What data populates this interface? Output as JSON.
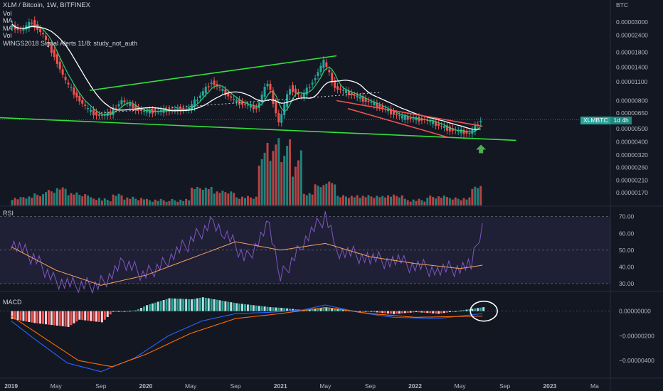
{
  "header": {
    "title": "XLM / Bitcoin, 1W, BITFINEX",
    "indicators": [
      "Vol",
      "MA",
      "MA",
      "Vol",
      "WINGS2018 Signal Alerts 11/8: study_not_auth"
    ]
  },
  "price_scale": {
    "currency": "BTC"
  },
  "price_badge": {
    "symbol": "XLMBTC",
    "countdown": "1d 4h"
  },
  "panes": {
    "rsi_label": "RSI",
    "macd_label": "MACD"
  },
  "colors": {
    "background": "#131722",
    "up": "#26a69a",
    "down": "#ef5350",
    "trendline": "#32e03c",
    "ma_fast": "#2ecc71",
    "ma_slow": "#ffffff",
    "rsi": "#7e57c2",
    "rsi_ma": "#f4a261",
    "macd": "#2962ff",
    "signal": "#ff6d00",
    "arrow": "#4caf50"
  },
  "chart_data": [
    {
      "type": "candlestick",
      "title": "XLM / Bitcoin, 1W, BITFINEX",
      "log_scale": true,
      "y_ticks": [
        "0.00003000",
        "0.00002400",
        "0.00001800",
        "0.00001400",
        "0.00001100",
        "0.00000800",
        "0.00000650",
        "0.00000500",
        "0.00000400",
        "0.00000320",
        "0.00000260",
        "0.00000210",
        "0.00000170"
      ],
      "x_ticks": [
        "2019",
        "May",
        "Sep",
        "2020",
        "May",
        "Sep",
        "2021",
        "May",
        "Sep",
        "2022",
        "May",
        "Sep",
        "2023",
        "Ma"
      ],
      "last_price_approx": 5.8e-06,
      "price_path": [
        {
          "date": "2019-01",
          "price": 2.85e-05
        },
        {
          "date": "2019-02",
          "price": 2.6e-05
        },
        {
          "date": "2019-03",
          "price": 3e-05
        },
        {
          "date": "2019-04",
          "price": 2.4e-05
        },
        {
          "date": "2019-05",
          "price": 1.7e-05
        },
        {
          "date": "2019-06",
          "price": 1.1e-05
        },
        {
          "date": "2019-07",
          "price": 8.5e-06
        },
        {
          "date": "2019-08",
          "price": 6.8e-06
        },
        {
          "date": "2019-09",
          "price": 6.2e-06
        },
        {
          "date": "2019-10",
          "price": 6.5e-06
        },
        {
          "date": "2019-11",
          "price": 8e-06
        },
        {
          "date": "2019-12",
          "price": 7.2e-06
        },
        {
          "date": "2020-01",
          "price": 6.6e-06
        },
        {
          "date": "2020-03",
          "price": 6.8e-06
        },
        {
          "date": "2020-05",
          "price": 7e-06
        },
        {
          "date": "2020-07",
          "price": 1.1e-05
        },
        {
          "date": "2020-09",
          "price": 8e-06
        },
        {
          "date": "2020-11",
          "price": 7e-06
        },
        {
          "date": "2020-12",
          "price": 1.1e-05
        },
        {
          "date": "2021-01",
          "price": 5.5e-06
        },
        {
          "date": "2021-02",
          "price": 1e-05
        },
        {
          "date": "2021-03",
          "price": 8.5e-06
        },
        {
          "date": "2021-04",
          "price": 1.1e-05
        },
        {
          "date": "2021-05",
          "price": 1.55e-05
        },
        {
          "date": "2021-06",
          "price": 1e-05
        },
        {
          "date": "2021-08",
          "price": 8.5e-06
        },
        {
          "date": "2021-10",
          "price": 7.2e-06
        },
        {
          "date": "2021-12",
          "price": 6e-06
        },
        {
          "date": "2022-02",
          "price": 5.8e-06
        },
        {
          "date": "2022-04",
          "price": 5e-06
        },
        {
          "date": "2022-06",
          "price": 4.6e-06
        },
        {
          "date": "2022-07",
          "price": 5.8e-06
        }
      ],
      "trendlines": [
        {
          "name": "upper channel",
          "from": {
            "date": "2019-08",
            "price": 9.5e-06
          },
          "to": {
            "date": "2021-06",
            "price": 1.7e-05
          }
        },
        {
          "name": "lower support",
          "from": {
            "date": "2018-12",
            "price": 6e-06
          },
          "to": {
            "date": "2022-10",
            "price": 4.1e-06
          }
        },
        {
          "name": "falling wedge upper",
          "from": {
            "date": "2021-06",
            "price": 8e-06
          },
          "to": {
            "date": "2022-07",
            "price": 5.2e-06
          }
        },
        {
          "name": "falling wedge lower",
          "from": {
            "date": "2021-07",
            "price": 7e-06
          },
          "to": {
            "date": "2022-04",
            "price": 4.3e-06
          }
        }
      ]
    },
    {
      "type": "bar",
      "series": [
        {
          "name": "Vol",
          "values": []
        }
      ],
      "note_visible": "volume histogram spikes around 2020-12 to 2021-01 and 2021-04 to 2021-05"
    },
    {
      "type": "line",
      "series": [
        {
          "name": "RSI"
        },
        {
          "name": "RSI MA"
        }
      ],
      "y_ticks": [
        "70.00",
        "60.00",
        "50.00",
        "40.00",
        "30.00"
      ],
      "ylim": [
        27,
        72
      ],
      "bands": [
        30,
        70
      ],
      "rsi_path": [
        {
          "date": "2019-01",
          "value": 55
        },
        {
          "date": "2019-03",
          "value": 45
        },
        {
          "date": "2019-05",
          "value": 32
        },
        {
          "date": "2019-07",
          "value": 28
        },
        {
          "date": "2019-09",
          "value": 30
        },
        {
          "date": "2019-11",
          "value": 42
        },
        {
          "date": "2020-01",
          "value": 35
        },
        {
          "date": "2020-03",
          "value": 45
        },
        {
          "date": "2020-05",
          "value": 55
        },
        {
          "date": "2020-07",
          "value": 68
        },
        {
          "date": "2020-08",
          "value": 60
        },
        {
          "date": "2020-10",
          "value": 45
        },
        {
          "date": "2020-12",
          "value": 65
        },
        {
          "date": "2021-01",
          "value": 33
        },
        {
          "date": "2021-03",
          "value": 55
        },
        {
          "date": "2021-05",
          "value": 70
        },
        {
          "date": "2021-06",
          "value": 50
        },
        {
          "date": "2021-09",
          "value": 45
        },
        {
          "date": "2021-12",
          "value": 42
        },
        {
          "date": "2022-03",
          "value": 38
        },
        {
          "date": "2022-06",
          "value": 40
        },
        {
          "date": "2022-07",
          "value": 66
        }
      ],
      "rsi_ma_path": [
        {
          "date": "2019-01",
          "value": 52
        },
        {
          "date": "2019-05",
          "value": 38
        },
        {
          "date": "2019-09",
          "value": 29
        },
        {
          "date": "2020-01",
          "value": 35
        },
        {
          "date": "2020-05",
          "value": 45
        },
        {
          "date": "2020-09",
          "value": 55
        },
        {
          "date": "2021-01",
          "value": 50
        },
        {
          "date": "2021-05",
          "value": 54
        },
        {
          "date": "2021-09",
          "value": 46
        },
        {
          "date": "2022-01",
          "value": 42
        },
        {
          "date": "2022-05",
          "value": 39
        },
        {
          "date": "2022-07",
          "value": 41
        }
      ]
    },
    {
      "type": "line",
      "series": [
        {
          "name": "MACD"
        },
        {
          "name": "Signal"
        },
        {
          "name": "Histogram"
        }
      ],
      "y_ticks": [
        "0.00000000",
        "−0.00000200",
        "−0.00000400"
      ],
      "ylim": [
        -5.2e-06,
        9e-07
      ],
      "macd_path": [
        {
          "date": "2019-01",
          "value": -8e-07
        },
        {
          "date": "2019-03",
          "value": -2.2e-06
        },
        {
          "date": "2019-06",
          "value": -4.2e-06
        },
        {
          "date": "2019-09",
          "value": -4.9e-06
        },
        {
          "date": "2019-12",
          "value": -3.8e-06
        },
        {
          "date": "2020-03",
          "value": -2e-06
        },
        {
          "date": "2020-06",
          "value": -8e-07
        },
        {
          "date": "2020-09",
          "value": -2e-07
        },
        {
          "date": "2020-12",
          "value": -1e-07
        },
        {
          "date": "2021-03",
          "value": 1e-07
        },
        {
          "date": "2021-05",
          "value": 5e-07
        },
        {
          "date": "2021-08",
          "value": -1e-07
        },
        {
          "date": "2021-11",
          "value": -5e-07
        },
        {
          "date": "2022-03",
          "value": -6e-07
        },
        {
          "date": "2022-07",
          "value": -2e-07
        }
      ],
      "signal_path": [
        {
          "date": "2019-01",
          "value": -4e-07
        },
        {
          "date": "2019-04",
          "value": -2.2e-06
        },
        {
          "date": "2019-07",
          "value": -4e-06
        },
        {
          "date": "2019-10",
          "value": -4.5e-06
        },
        {
          "date": "2020-01",
          "value": -3.5e-06
        },
        {
          "date": "2020-05",
          "value": -1.8e-06
        },
        {
          "date": "2020-09",
          "value": -6e-07
        },
        {
          "date": "2021-01",
          "value": -2e-07
        },
        {
          "date": "2021-05",
          "value": 3e-07
        },
        {
          "date": "2021-09",
          "value": -2e-07
        },
        {
          "date": "2022-01",
          "value": -5e-07
        },
        {
          "date": "2022-07",
          "value": -4e-07
        }
      ],
      "highlight": "circled area at latest bars"
    }
  ]
}
